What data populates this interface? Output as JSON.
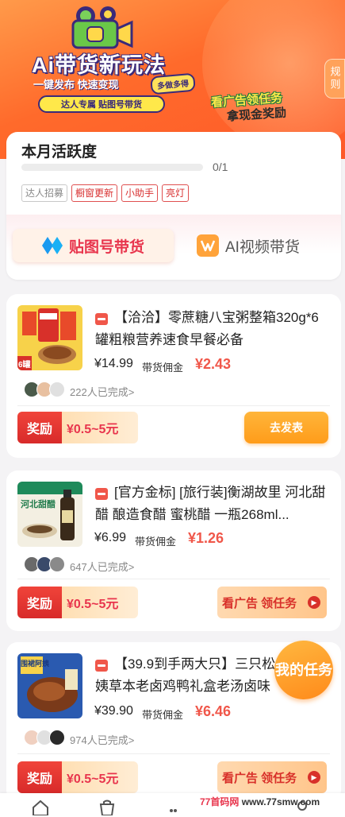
{
  "banner": {
    "title": "Ai带货新玩法",
    "subtitle": "一键发布  快速变现",
    "tag": "多做多得",
    "pill": "达人专属  贴图号带货",
    "ad_title": "看广告领任务",
    "ad_subtitle": "拿现金奖励",
    "rules_label": "规则"
  },
  "activity": {
    "title": "本月活跃度",
    "progress_text": "0/1",
    "progress_value": 0,
    "tags": [
      {
        "label": "达人招募",
        "style": "gray"
      },
      {
        "label": "橱窗更新",
        "style": "red"
      },
      {
        "label": "小助手",
        "style": "red"
      },
      {
        "label": "亮灯",
        "style": "red"
      }
    ]
  },
  "tabs": {
    "active": "贴图号带货",
    "inactive": "AI视频带货"
  },
  "products": [
    {
      "title": "【洽洽】零蔗糖八宝粥整箱320g*6罐粗粮营养速食早餐必备",
      "price": "¥14.99",
      "commission_label": "带货佣金",
      "commission": "¥2.43",
      "completed": "222人已完成>",
      "reward_label": "奖励",
      "reward": "¥0.5~5元",
      "action": "去发表"
    },
    {
      "title": "[官方金标] [旅行装]衡湖故里 河北甜醋 酿造食醋 蜜桃醋 一瓶268ml...",
      "price": "¥6.99",
      "commission_label": "带货佣金",
      "commission": "¥1.26",
      "completed": "647人已完成>",
      "reward_label": "奖励",
      "reward": "¥0.5~5元",
      "action": "看广告 领任务"
    },
    {
      "title": "【39.9到手两大只】三只松鼠围裙阿姨草本老卤鸡鸭礼盒老汤卤味",
      "price": "¥39.90",
      "commission_label": "带货佣金",
      "commission": "¥6.46",
      "completed": "974人已完成>",
      "reward_label": "奖励",
      "reward": "¥0.5~5元",
      "action": "看广告 领任务"
    }
  ],
  "thumbs": {
    "p1_badge": "6罐",
    "p2_text": "河北甜醋",
    "p3_text": "围裙阿姨"
  },
  "float": {
    "label": "我的任务"
  },
  "watermark": {
    "text": "77首码网",
    "url": "www.77smw.com"
  },
  "colors": {
    "accent": "#f0574a",
    "orange": "#ff9c1a",
    "banner": "#ff6a2b"
  }
}
